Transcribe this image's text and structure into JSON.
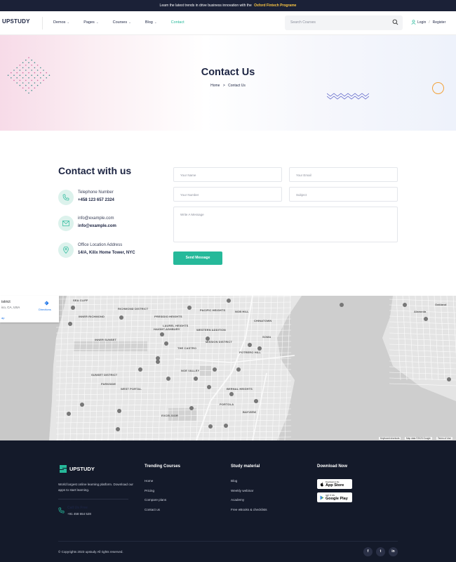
{
  "announcement": {
    "text": "Learn the latest trends in drive business innovation with the",
    "highlight": "Oxford Fintech Programe"
  },
  "header": {
    "logo": "UPSTUDY",
    "nav": [
      {
        "label": "Demos",
        "has_dropdown": true
      },
      {
        "label": "Pages",
        "has_dropdown": true
      },
      {
        "label": "Courses",
        "has_dropdown": true
      },
      {
        "label": "Blog",
        "has_dropdown": true
      },
      {
        "label": "Contact",
        "has_dropdown": false,
        "active": true
      }
    ],
    "search_placeholder": "Search Courses",
    "login": "Login",
    "separator": "/",
    "register": "Register"
  },
  "hero": {
    "title": "Contact Us",
    "breadcrumb": {
      "home": "Home",
      "separator": ">",
      "current": "Contact Us"
    }
  },
  "contact": {
    "title": "Contact with us",
    "items": [
      {
        "icon": "phone-icon",
        "label": "Telephone Number",
        "value": "+458 123 657 2324"
      },
      {
        "icon": "mail-icon",
        "label": "info@example.com",
        "value": "info@example.com"
      },
      {
        "icon": "location-pin-icon",
        "label": "Office Location Address",
        "value": "14/A, Kilix Home Tower, NYC"
      }
    ],
    "form": {
      "name_placeholder": "Your Name",
      "email_placeholder": "Your Email",
      "number_placeholder": "Your Number",
      "subject_placeholder": "Subject",
      "message_placeholder": "Write A Message",
      "submit_label": "Send Message"
    }
  },
  "map": {
    "card": {
      "title": "istrict",
      "subtitle": "ico, CA, USA",
      "directions": "Directions",
      "link": "ap"
    },
    "labels": [
      "SEA CLIFF",
      "RICHMOND DISTRICT",
      "PRESIDIO HEIGHTS",
      "LAUREL HEIGHTS",
      "PACIFIC HEIGHTS",
      "NOB HILL",
      "CHINATOWN",
      "WESTERN ADDITION",
      "SOMA",
      "INNER RICHMOND",
      "HAIGHT-ASHBURY",
      "THE CASTRO",
      "MISSION DISTRICT",
      "POTRERO HILL",
      "INNER SUNSET",
      "SUNSET DISTRICT",
      "PARKSIDE",
      "WEST PORTAL",
      "NOE VALLEY",
      "BERNAL HEIGHTS",
      "PORTOLA",
      "BAYVIEW",
      "EXCELSIOR",
      "Alameda",
      "Oakland"
    ],
    "attribution": [
      "Keyboard shortcuts",
      "Map data ©2023 Google",
      "Terms of Use"
    ]
  },
  "footer": {
    "logo": "UPSTUDY",
    "description": "World largest online learning platform. Download our apps to start learning.",
    "call": {
      "title": "Call Us Free",
      "number": "+91 458 654 528"
    },
    "columns": [
      {
        "title": "Trending Courses",
        "links": [
          "Home",
          "Pricing",
          "Compare plans",
          "Contact us"
        ]
      },
      {
        "title": "Study material",
        "links": [
          "Blog",
          "Weekly webinar",
          "Academy",
          "Free eBooks & checklists"
        ]
      }
    ],
    "download": {
      "title": "Download Now",
      "app_store": {
        "small": "Download on the",
        "big": "App Store"
      },
      "google_play": {
        "small": "GET IT ON",
        "big": "Google Play"
      }
    },
    "copyright": "© Copyrights 2023 upstudy All rights reserved.",
    "social": [
      {
        "icon": "facebook-icon",
        "glyph": "f"
      },
      {
        "icon": "twitter-icon",
        "glyph": "t"
      },
      {
        "icon": "linkedin-icon",
        "glyph": "in"
      }
    ]
  },
  "colors": {
    "accent": "#26b99a",
    "dark": "#141a2a",
    "heading": "#1c2442",
    "highlight": "#f9c543",
    "ring": "#f2a23a"
  }
}
